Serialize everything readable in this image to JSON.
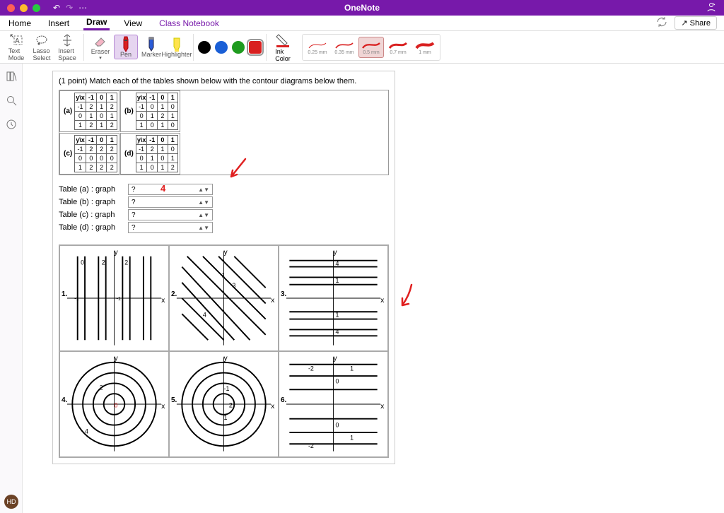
{
  "app": {
    "title": "OneNote"
  },
  "menu": {
    "home": "Home",
    "insert": "Insert",
    "draw": "Draw",
    "view": "View",
    "classnb": "Class Notebook",
    "share": "Share"
  },
  "ribbon": {
    "text_mode": "Text\nMode",
    "lasso": "Lasso\nSelect",
    "insert_space": "Insert\nSpace",
    "eraser": "Eraser",
    "pen": "Pen",
    "marker": "Marker",
    "highlighter": "Highlighter",
    "ink_color": "Ink\nColor",
    "colors": {
      "black": "#000000",
      "blue": "#1a5fd6",
      "green": "#1f9b1f",
      "red": "#d92020"
    },
    "strokes": [
      "0.25 mm",
      "0.35 mm",
      "0.5 mm",
      "0.7 mm",
      "1 mm"
    ],
    "selected_stroke": "0.5 mm"
  },
  "note": {
    "question": "(1 point) Match each of the tables shown below with the contour diagrams below them.",
    "table_labels": [
      "(a)",
      "(b)",
      "(c)",
      "(d)"
    ],
    "header": [
      "y\\x",
      "-1",
      "0",
      "1"
    ],
    "tables": {
      "a": [
        [
          "-1",
          "2",
          "1",
          "2"
        ],
        [
          "0",
          "1",
          "0",
          "1"
        ],
        [
          "1",
          "2",
          "1",
          "2"
        ]
      ],
      "b": [
        [
          "-1",
          "0",
          "1",
          "0"
        ],
        [
          "0",
          "1",
          "2",
          "1"
        ],
        [
          "1",
          "0",
          "1",
          "0"
        ]
      ],
      "c": [
        [
          "-1",
          "2",
          "2",
          "2"
        ],
        [
          "0",
          "0",
          "0",
          "0"
        ],
        [
          "1",
          "2",
          "2",
          "2"
        ]
      ],
      "d": [
        [
          "-1",
          "2",
          "1",
          "0"
        ],
        [
          "0",
          "1",
          "0",
          "1"
        ],
        [
          "1",
          "0",
          "1",
          "2"
        ]
      ]
    },
    "match": {
      "a": "Table (a) : graph",
      "b": "Table (b) : graph",
      "c": "Table (c) : graph",
      "d": "Table (d) : graph",
      "placeholder": "?"
    },
    "ink_answer_a": "4",
    "graph_labels": [
      "1.",
      "2.",
      "3.",
      "4.",
      "5.",
      "6."
    ],
    "axis_y": "y",
    "axis_x": "x"
  },
  "badge": "HD"
}
